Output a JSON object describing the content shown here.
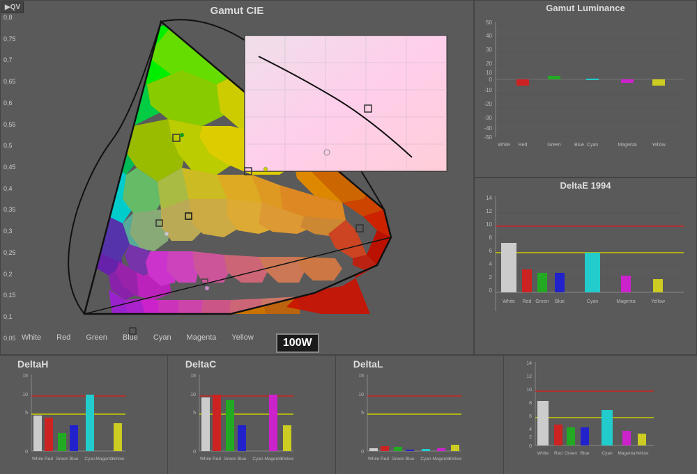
{
  "gamutCIE": {
    "title": "Gamut CIE",
    "yLabels": [
      "0,8",
      "0,75",
      "0,7",
      "0,65",
      "0,6",
      "0,55",
      "0,5",
      "0,45",
      "0,4",
      "0,35",
      "0,3",
      "0,25",
      "0,2",
      "0,15",
      "0,1",
      "0,05"
    ],
    "colorLabels": [
      "White",
      "Red",
      "Green",
      "Blue",
      "Cyan",
      "Magenta",
      "Yellow"
    ]
  },
  "gamutLuminance": {
    "title": "Gamut Luminance",
    "yLabels": [
      "50",
      "40",
      "30",
      "20",
      "10",
      "0",
      "-10",
      "-20",
      "-30",
      "-40",
      "-50"
    ],
    "xLabels": [
      "White",
      "Red",
      "Green",
      "Blue",
      "Cyan",
      "Magenta",
      "Yellow"
    ],
    "bars": [
      {
        "color": "#cc2222",
        "value": -5,
        "label": "Red"
      },
      {
        "color": "#22aa22",
        "value": 3,
        "label": "Green"
      },
      {
        "color": "#22cccc",
        "value": 0,
        "label": "Cyan"
      },
      {
        "color": "#cc22cc",
        "value": -3,
        "label": "Magenta"
      },
      {
        "color": "#cccc22",
        "value": -5,
        "label": "Yellow"
      }
    ]
  },
  "deltaE1994": {
    "title": "DeltaE 1994",
    "yLabels": [
      "14",
      "12",
      "10",
      "8",
      "6",
      "4",
      "2",
      "0"
    ],
    "xLabels": [
      "White",
      "Red",
      "Green",
      "Blue",
      "Cyan",
      "Magenta",
      "Yellow"
    ],
    "redLine": 10,
    "yellowLine": 5,
    "bars": [
      {
        "color": "#cccccc",
        "value": 7.5,
        "label": "White"
      },
      {
        "color": "#cc2222",
        "value": 3.5,
        "label": "Red"
      },
      {
        "color": "#22aa22",
        "value": 3,
        "label": "Green"
      },
      {
        "color": "#2222cc",
        "value": 3,
        "label": "Blue"
      },
      {
        "color": "#22cccc",
        "value": 6,
        "label": "Cyan"
      },
      {
        "color": "#cc22cc",
        "value": 2.5,
        "label": "Magenta"
      },
      {
        "color": "#cccc22",
        "value": 2,
        "label": "Yellow"
      }
    ]
  },
  "deltaH": {
    "title": "DeltaH",
    "yMax": 15,
    "redLine": 10,
    "yellowLine": 5,
    "xLabels": [
      "White",
      "Red",
      "Green",
      "Blue",
      "Cyan",
      "Yellow",
      "Magenta"
    ],
    "bars": [
      {
        "color": "#cccccc",
        "value": 7,
        "label": "White"
      },
      {
        "color": "#cc2222",
        "value": 6.5,
        "label": "Red"
      },
      {
        "color": "#22aa22",
        "value": 3.5,
        "label": "Green"
      },
      {
        "color": "#2222cc",
        "value": 5,
        "label": "Blue"
      },
      {
        "color": "#22cccc",
        "value": 11,
        "label": "Cyan"
      },
      {
        "color": "#cccc22",
        "value": 5.5,
        "label": "Yellow"
      }
    ]
  },
  "deltaC": {
    "title": "DeltaC",
    "yMax": 15,
    "redLine": 10,
    "yellowLine": 5,
    "xLabels": [
      "White",
      "Red",
      "Green",
      "Blue",
      "Cyan",
      "Yellow",
      "Magenta"
    ],
    "bars": [
      {
        "color": "#cccccc",
        "value": 10.5,
        "label": "White"
      },
      {
        "color": "#cc2222",
        "value": 11,
        "label": "Red"
      },
      {
        "color": "#22aa22",
        "value": 10,
        "label": "Green"
      },
      {
        "color": "#2222cc",
        "value": 5,
        "label": "Blue"
      },
      {
        "color": "#cc22cc",
        "value": 11,
        "label": "Magenta"
      },
      {
        "color": "#cccc22",
        "value": 5,
        "label": "Yellow"
      }
    ]
  },
  "deltaL": {
    "title": "DeltaL",
    "yMax": 15,
    "redLine": 10,
    "yellowLine": 5,
    "xLabels": [
      "White",
      "Red",
      "Green",
      "Blue",
      "Cyan",
      "Yellow",
      "Magenta"
    ],
    "bars": [
      {
        "color": "#cccccc",
        "value": 0.5,
        "label": "White"
      },
      {
        "color": "#cc2222",
        "value": 1,
        "label": "Red"
      },
      {
        "color": "#22aa22",
        "value": 0.8,
        "label": "Green"
      },
      {
        "color": "#2222cc",
        "value": 0.3,
        "label": "Blue"
      },
      {
        "color": "#22cccc",
        "value": 0.4,
        "label": "Cyan"
      },
      {
        "color": "#cc22cc",
        "value": 0.6,
        "label": "Magenta"
      },
      {
        "color": "#cccc22",
        "value": 1.2,
        "label": "Yellow"
      }
    ]
  },
  "badge": "100W",
  "logo": "QV"
}
